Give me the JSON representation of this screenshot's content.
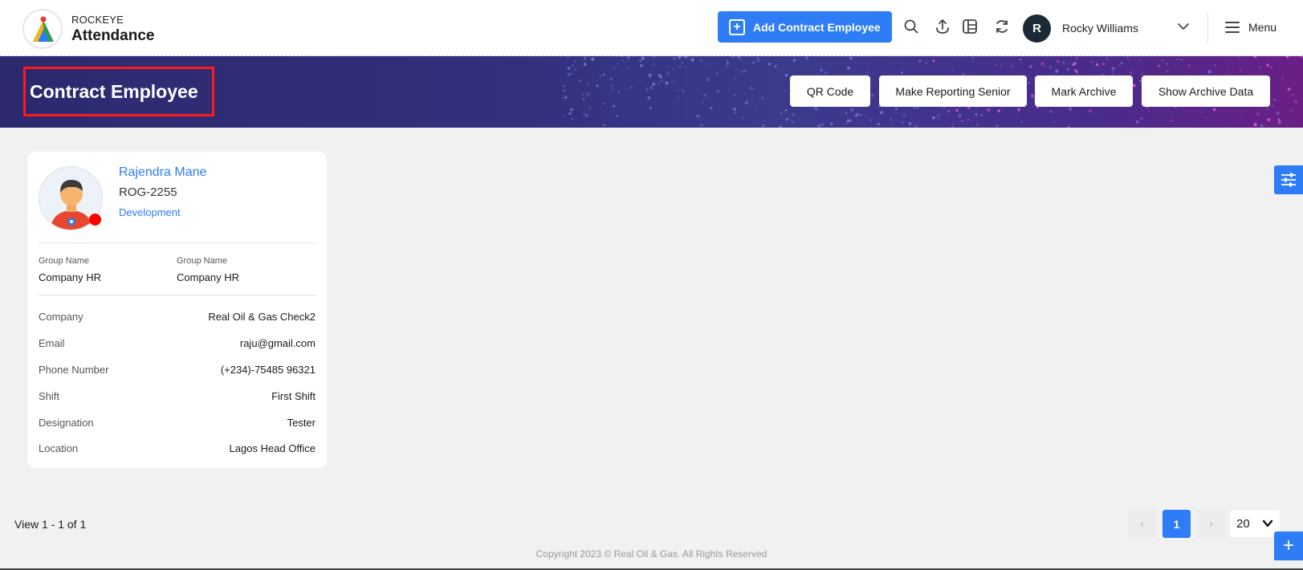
{
  "app": {
    "brand_small": "ROCKEYE",
    "brand_big": "Attendance"
  },
  "header": {
    "add_button_label": "Add Contract Employee",
    "icons": [
      "search-icon",
      "upload-icon",
      "layout-icon",
      "refresh-icon"
    ],
    "user_initial": "R",
    "user_name": "Rocky Williams",
    "menu_label": "Menu"
  },
  "banner": {
    "title": "Contract Employee",
    "buttons": [
      "QR Code",
      "Make Reporting Senior",
      "Mark Archive",
      "Show Archive Data"
    ]
  },
  "employee": {
    "name": "Rajendra Mane",
    "code": "ROG-2255",
    "department": "Development",
    "status_color": "#ff0000",
    "groups": [
      {
        "label": "Group Name",
        "value": "Company HR"
      },
      {
        "label": "Group Name",
        "value": "Company HR"
      }
    ],
    "details": [
      {
        "label": "Company",
        "value": "Real Oil & Gas Check2"
      },
      {
        "label": "Email",
        "value": "raju@gmail.com"
      },
      {
        "label": "Phone Number",
        "value": "(+234)-75485 96321"
      },
      {
        "label": "Shift",
        "value": "First Shift"
      },
      {
        "label": "Designation",
        "value": "Tester"
      },
      {
        "label": "Location",
        "value": "Lagos Head Office"
      }
    ]
  },
  "pagination": {
    "view_text": "View 1 - 1 of 1",
    "prev": "‹",
    "current_page": "1",
    "next": "›",
    "per_page": "20"
  },
  "footer": {
    "copyright": "Copyright 2023 © Real Oil & Gas. All Rights Reserved"
  },
  "colors": {
    "accent": "#2e7cf6",
    "banner_start": "#2c2a6e",
    "banner_end": "#6a1f86",
    "highlight_border": "#ff1a1a"
  }
}
